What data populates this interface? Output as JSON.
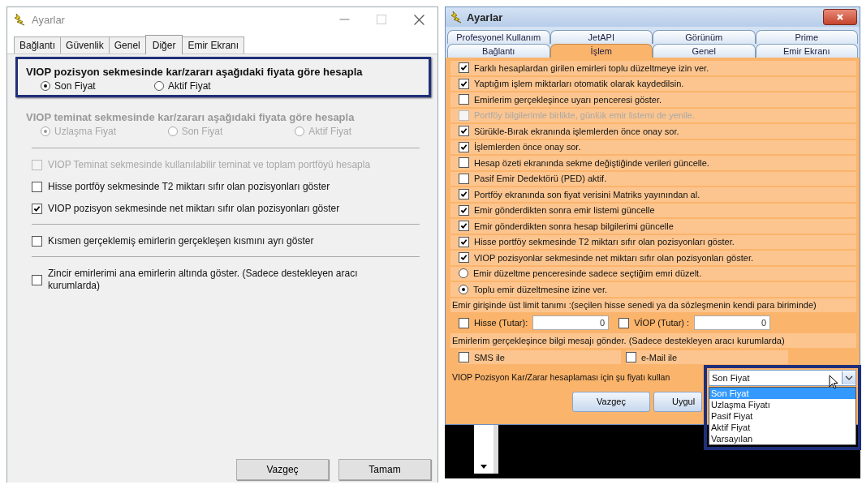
{
  "left_window": {
    "title": "Ayarlar",
    "tabs": [
      {
        "label": "Bağlantı",
        "selected": false
      },
      {
        "label": "Güvenlik",
        "selected": false
      },
      {
        "label": "Genel",
        "selected": false
      },
      {
        "label": "Diğer",
        "selected": true
      },
      {
        "label": "Emir Ekranı",
        "selected": false
      }
    ],
    "items": [
      {
        "kind": "radio_group",
        "heading": "VIOP pozisyon sekmesinde kar/zararı aşağıdaki fiyata göre hesapla",
        "disabled": false,
        "highlighted": true,
        "options": [
          {
            "label": "Son Fiyat",
            "selected": true
          },
          {
            "label": "Aktif Fiyat",
            "selected": false
          }
        ]
      },
      {
        "kind": "radio_group",
        "heading": "VIOP teminat sekmesinde kar/zararı aşağıdaki fiyata göre hesapla",
        "disabled": true,
        "highlighted": false,
        "options": [
          {
            "label": "Uzlaşma Fiyat",
            "selected": true
          },
          {
            "label": "Son Fiyat",
            "selected": false
          },
          {
            "label": "Aktif Fiyat",
            "selected": false
          }
        ]
      },
      {
        "kind": "separator"
      },
      {
        "kind": "checkbox",
        "label": "VIOP Teminat sekmesinde kullanılabilir teminat ve toplam portföyü hesapla",
        "checked": false,
        "disabled": true
      },
      {
        "kind": "checkbox",
        "label": "Hisse portföy sekmesinde T2 miktarı sıfır olan pozisyonları göster",
        "checked": false,
        "disabled": false
      },
      {
        "kind": "checkbox",
        "label": "VIOP pozisyon sekmesinde net miktarı sıfır olan pozisyonları göster",
        "checked": true,
        "disabled": false
      },
      {
        "kind": "separator"
      },
      {
        "kind": "checkbox",
        "label": "Kısmen gerçeklemiş emirlerin gerçekleşen kısmını ayrı göster",
        "checked": false,
        "disabled": false
      },
      {
        "kind": "separator"
      },
      {
        "kind": "checkbox",
        "label": "Zincir emirlerimi ana emirlerin altında göster. (Sadece destekleyen aracı kurumlarda)",
        "checked": false,
        "disabled": false
      }
    ],
    "buttons": [
      "Vazgeç",
      "Tamam"
    ]
  },
  "right_window": {
    "title": "Ayarlar",
    "tab_rows": [
      [
        {
          "label": "Profesyonel Kullanım",
          "selected": false
        },
        {
          "label": "JetAPI",
          "selected": false
        },
        {
          "label": "Görünüm",
          "selected": false
        },
        {
          "label": "Prime",
          "selected": false
        }
      ],
      [
        {
          "label": "Bağlantı",
          "selected": false
        },
        {
          "label": "İşlem",
          "selected": true
        },
        {
          "label": "Genel",
          "selected": false
        },
        {
          "label": "Emir Ekranı",
          "selected": false
        }
      ]
    ],
    "items": [
      {
        "kind": "checkbox",
        "label": "Farklı hesaplardan girilen emirleri toplu düzeltmeye izin ver.",
        "checked": true,
        "disabled": false
      },
      {
        "kind": "checkbox",
        "label": "Yaptığım işlem miktarları otomatik olarak kaydedilsin.",
        "checked": true,
        "disabled": false
      },
      {
        "kind": "checkbox",
        "label": "Emirlerim gerçekleşince uyarı penceresi göster.",
        "checked": false,
        "disabled": false
      },
      {
        "kind": "checkbox",
        "label": "Portföy bilgilerimle birlikte, günlük emir listemi de yenile.",
        "checked": false,
        "disabled": true
      },
      {
        "kind": "checkbox",
        "label": "Sürükle-Bırak ekranında işlemlerden önce onay sor.",
        "checked": true,
        "disabled": false
      },
      {
        "kind": "checkbox",
        "label": "İşlemlerden önce onay sor.",
        "checked": true,
        "disabled": false
      },
      {
        "kind": "checkbox",
        "label": "Hesap özeti ekranında sekme değiştiğinde verileri güncelle.",
        "checked": false,
        "disabled": false
      },
      {
        "kind": "checkbox",
        "label": "Pasif Emir Dedektörü (PED) aktif.",
        "checked": false,
        "disabled": false
      },
      {
        "kind": "checkbox",
        "label": "Portföy ekranında son fiyat verisini Matriks yayınından al.",
        "checked": true,
        "disabled": false
      },
      {
        "kind": "checkbox",
        "label": "Emir gönderdikten sonra emir listemi güncelle",
        "checked": true,
        "disabled": false
      },
      {
        "kind": "checkbox",
        "label": "Emir gönderdikten sonra hesap bilgilerimi güncelle",
        "checked": true,
        "disabled": false
      },
      {
        "kind": "checkbox",
        "label": "Hisse portföy sekmesinde T2 miktarı sıfır olan pozisyonları göster.",
        "checked": true,
        "disabled": false
      },
      {
        "kind": "checkbox",
        "label": "VIOP pozisyonlar sekmesinde net miktarı sıfır olan pozisyonları göster.",
        "checked": true,
        "disabled": false
      },
      {
        "kind": "radio",
        "label": "Emir düzeltme penceresinde sadece seçtiğim emri düzelt.",
        "selected": false
      },
      {
        "kind": "radio",
        "label": "Toplu emir düzeltmesine izine ver.",
        "selected": true
      },
      {
        "kind": "note",
        "label": "Emir girişinde üst limit tanımı :(seçilen hisse senedi ya da sözleşmenin kendi para biriminde)"
      },
      {
        "kind": "amount_fields",
        "fields": [
          {
            "label": "Hisse (Tutar):",
            "checked": false,
            "value": "0"
          },
          {
            "label": "VİOP (Tutar) :",
            "checked": false,
            "value": "0"
          }
        ]
      },
      {
        "kind": "note",
        "label": "Emirlerim gerçekleşince bilgi mesajı gönder. (Sadece destekleyen aracı kurumlarda)"
      },
      {
        "kind": "checkbox_pair",
        "boxes": [
          {
            "label": "SMS ile",
            "checked": false
          },
          {
            "label": "e-Mail ile",
            "checked": false
          }
        ]
      },
      {
        "kind": "select",
        "label": "VIOP Pozisyon Kar/Zarar hesaplaması için şu fiyatı kullan",
        "value": "Son Fiyat",
        "highlighted": true,
        "expanded": true,
        "options": [
          {
            "label": "Son Fiyat",
            "selected": true
          },
          {
            "label": "Uzlaşma Fiyatı",
            "selected": false
          },
          {
            "label": "Pasif Fiyat",
            "selected": false
          },
          {
            "label": "Aktif Fiyat",
            "selected": false
          },
          {
            "label": "Varsayılan",
            "selected": false
          }
        ]
      }
    ],
    "buttons": [
      "Vazgeç",
      "Uygul"
    ]
  }
}
